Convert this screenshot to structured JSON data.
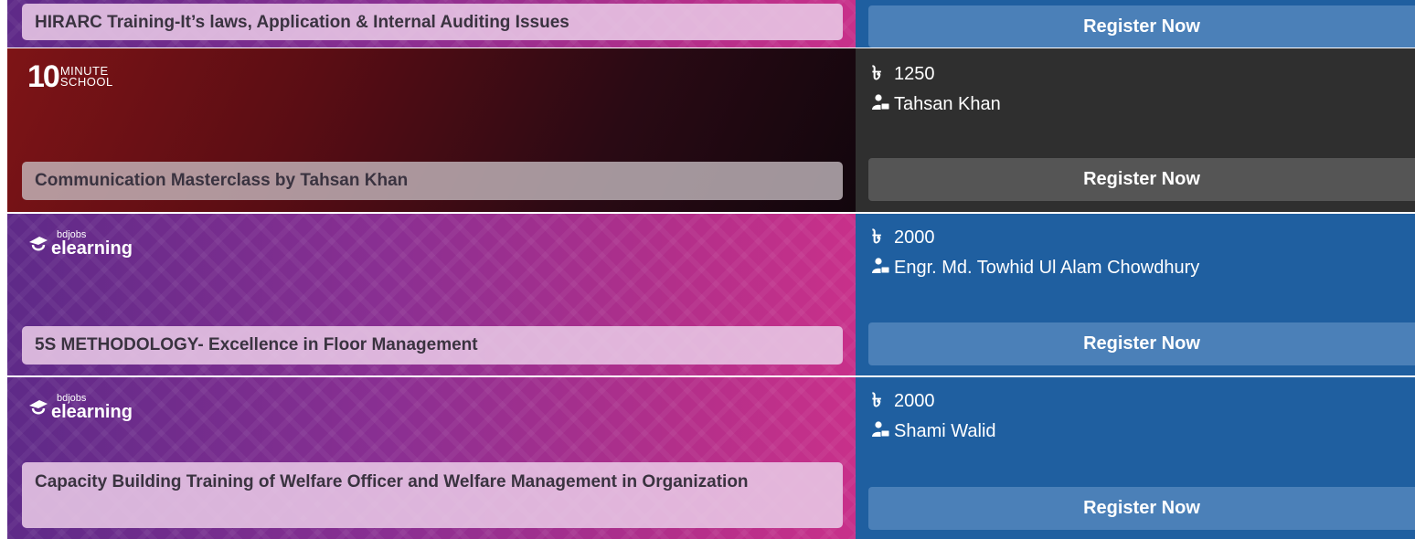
{
  "register_label": "Register Now",
  "currency_symbol": "৳",
  "colors": {
    "right_panel_blue": "#1f5fa0",
    "right_panel_dark": "#2f2f2f",
    "button_blue": "#4b80b8",
    "button_dark": "#555555"
  },
  "logos": {
    "tenmin_number": "10",
    "tenmin_line1": "MINUTE",
    "tenmin_line2": "SCHOOL",
    "elearning_small": "bdjobs",
    "elearning_big": "elearning"
  },
  "courses": [
    {
      "title": "HIRARC Training-It’s laws, Application & Internal Auditing Issues",
      "register": "Register Now"
    },
    {
      "provider": "10 Minute School",
      "title": "Communication Masterclass by Tahsan Khan",
      "price": "1250",
      "trainer": "Tahsan Khan",
      "register": "Register Now"
    },
    {
      "provider": "bdjobs elearning",
      "title": "5S METHODOLOGY- Excellence in Floor Management",
      "price": "2000",
      "trainer": "Engr. Md. Towhid Ul Alam Chowdhury",
      "register": "Register Now"
    },
    {
      "provider": "bdjobs elearning",
      "title": "Capacity Building Training of Welfare Officer and Welfare Management in Organization",
      "price": "2000",
      "trainer": "Shami Walid",
      "register": "Register Now"
    }
  ]
}
